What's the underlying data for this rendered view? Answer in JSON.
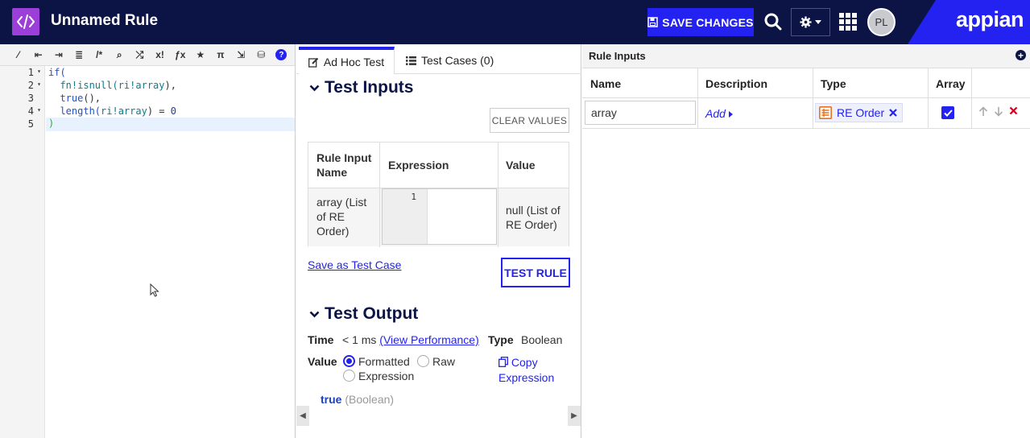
{
  "header": {
    "title": "Unnamed Rule",
    "save_label": "SAVE CHANGES",
    "avatar_initials": "PL",
    "brand": "appian"
  },
  "editor": {
    "toolbar_icons": [
      "magic-wand-icon",
      "outdent-icon",
      "indent-icon",
      "format-icon",
      "comment-icon",
      "search-icon",
      "shuffle-icon",
      "x-factorial-icon",
      "function-icon",
      "star-icon",
      "pi-icon",
      "export-icon",
      "data-search-icon",
      "help-icon"
    ],
    "toolbar_glyphs": [
      "⁄",
      "⇤",
      "⇥",
      "≣",
      "/*",
      "⌕",
      "⤮",
      "x!",
      "ƒx",
      "★",
      "π",
      "⇲",
      "⛁",
      "?"
    ],
    "lines": [
      {
        "num": "1",
        "fold": true
      },
      {
        "num": "2",
        "fold": true
      },
      {
        "num": "3",
        "fold": false
      },
      {
        "num": "4",
        "fold": true
      },
      {
        "num": "5",
        "fold": false
      }
    ],
    "code": {
      "l1_kw": "if(",
      "l2_fn": "fn!isnull(",
      "l2_arg": "ri!array",
      "l2_end": "),",
      "l3_kw": "true",
      "l3_end": "(),",
      "l4_kw": "length(",
      "l4_arg": "ri!array",
      "l4_mid": ") = ",
      "l4_num": "0",
      "l5": ")"
    }
  },
  "test_panel": {
    "tabs": [
      {
        "label": "Ad Hoc Test",
        "active": true
      },
      {
        "label": "Test Cases (0)",
        "active": false
      }
    ],
    "inputs_title": "Test Inputs",
    "clear_label": "CLEAR VALUES",
    "table": {
      "headers": [
        "Rule Input Name",
        "Expression",
        "Value"
      ],
      "row": {
        "name": "array (List of RE Order)",
        "expr_line": "1",
        "value": "null (List of RE Order)"
      }
    },
    "save_case_label": "Save as Test Case",
    "test_rule_label": "TEST RULE",
    "output_title": "Test Output",
    "time_label": "Time",
    "time_value": "< 1 ms",
    "view_perf": "(View Performance)",
    "type_label": "Type",
    "type_value": "Boolean",
    "value_label": "Value",
    "options": [
      {
        "label": "Formatted",
        "selected": true
      },
      {
        "label": "Raw",
        "selected": false
      },
      {
        "label": "Expression",
        "selected": false
      }
    ],
    "copy_label": "Copy Expression",
    "result_value": "true",
    "result_type": "(Boolean)"
  },
  "rule_inputs": {
    "title": "Rule Inputs",
    "headers": [
      "Name",
      "Description",
      "Type",
      "Array"
    ],
    "row": {
      "name": "array",
      "description_link": "Add",
      "type": "RE Order",
      "array": true
    }
  },
  "colors": {
    "navy": "#0c1446",
    "accent": "#2322f0",
    "app_icon": "#9c3fd8",
    "type_icon": "#e8721c",
    "delete": "#d0021b"
  }
}
